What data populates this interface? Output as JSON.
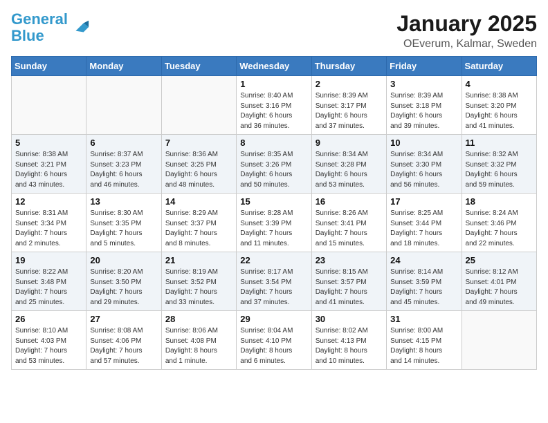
{
  "header": {
    "logo_line1": "General",
    "logo_line2": "Blue",
    "title": "January 2025",
    "subtitle": "OEverum, Kalmar, Sweden"
  },
  "days_of_week": [
    "Sunday",
    "Monday",
    "Tuesday",
    "Wednesday",
    "Thursday",
    "Friday",
    "Saturday"
  ],
  "weeks": [
    [
      {
        "day": "",
        "info": ""
      },
      {
        "day": "",
        "info": ""
      },
      {
        "day": "",
        "info": ""
      },
      {
        "day": "1",
        "info": "Sunrise: 8:40 AM\nSunset: 3:16 PM\nDaylight: 6 hours\nand 36 minutes."
      },
      {
        "day": "2",
        "info": "Sunrise: 8:39 AM\nSunset: 3:17 PM\nDaylight: 6 hours\nand 37 minutes."
      },
      {
        "day": "3",
        "info": "Sunrise: 8:39 AM\nSunset: 3:18 PM\nDaylight: 6 hours\nand 39 minutes."
      },
      {
        "day": "4",
        "info": "Sunrise: 8:38 AM\nSunset: 3:20 PM\nDaylight: 6 hours\nand 41 minutes."
      }
    ],
    [
      {
        "day": "5",
        "info": "Sunrise: 8:38 AM\nSunset: 3:21 PM\nDaylight: 6 hours\nand 43 minutes."
      },
      {
        "day": "6",
        "info": "Sunrise: 8:37 AM\nSunset: 3:23 PM\nDaylight: 6 hours\nand 46 minutes."
      },
      {
        "day": "7",
        "info": "Sunrise: 8:36 AM\nSunset: 3:25 PM\nDaylight: 6 hours\nand 48 minutes."
      },
      {
        "day": "8",
        "info": "Sunrise: 8:35 AM\nSunset: 3:26 PM\nDaylight: 6 hours\nand 50 minutes."
      },
      {
        "day": "9",
        "info": "Sunrise: 8:34 AM\nSunset: 3:28 PM\nDaylight: 6 hours\nand 53 minutes."
      },
      {
        "day": "10",
        "info": "Sunrise: 8:34 AM\nSunset: 3:30 PM\nDaylight: 6 hours\nand 56 minutes."
      },
      {
        "day": "11",
        "info": "Sunrise: 8:32 AM\nSunset: 3:32 PM\nDaylight: 6 hours\nand 59 minutes."
      }
    ],
    [
      {
        "day": "12",
        "info": "Sunrise: 8:31 AM\nSunset: 3:34 PM\nDaylight: 7 hours\nand 2 minutes."
      },
      {
        "day": "13",
        "info": "Sunrise: 8:30 AM\nSunset: 3:35 PM\nDaylight: 7 hours\nand 5 minutes."
      },
      {
        "day": "14",
        "info": "Sunrise: 8:29 AM\nSunset: 3:37 PM\nDaylight: 7 hours\nand 8 minutes."
      },
      {
        "day": "15",
        "info": "Sunrise: 8:28 AM\nSunset: 3:39 PM\nDaylight: 7 hours\nand 11 minutes."
      },
      {
        "day": "16",
        "info": "Sunrise: 8:26 AM\nSunset: 3:41 PM\nDaylight: 7 hours\nand 15 minutes."
      },
      {
        "day": "17",
        "info": "Sunrise: 8:25 AM\nSunset: 3:44 PM\nDaylight: 7 hours\nand 18 minutes."
      },
      {
        "day": "18",
        "info": "Sunrise: 8:24 AM\nSunset: 3:46 PM\nDaylight: 7 hours\nand 22 minutes."
      }
    ],
    [
      {
        "day": "19",
        "info": "Sunrise: 8:22 AM\nSunset: 3:48 PM\nDaylight: 7 hours\nand 25 minutes."
      },
      {
        "day": "20",
        "info": "Sunrise: 8:20 AM\nSunset: 3:50 PM\nDaylight: 7 hours\nand 29 minutes."
      },
      {
        "day": "21",
        "info": "Sunrise: 8:19 AM\nSunset: 3:52 PM\nDaylight: 7 hours\nand 33 minutes."
      },
      {
        "day": "22",
        "info": "Sunrise: 8:17 AM\nSunset: 3:54 PM\nDaylight: 7 hours\nand 37 minutes."
      },
      {
        "day": "23",
        "info": "Sunrise: 8:15 AM\nSunset: 3:57 PM\nDaylight: 7 hours\nand 41 minutes."
      },
      {
        "day": "24",
        "info": "Sunrise: 8:14 AM\nSunset: 3:59 PM\nDaylight: 7 hours\nand 45 minutes."
      },
      {
        "day": "25",
        "info": "Sunrise: 8:12 AM\nSunset: 4:01 PM\nDaylight: 7 hours\nand 49 minutes."
      }
    ],
    [
      {
        "day": "26",
        "info": "Sunrise: 8:10 AM\nSunset: 4:03 PM\nDaylight: 7 hours\nand 53 minutes."
      },
      {
        "day": "27",
        "info": "Sunrise: 8:08 AM\nSunset: 4:06 PM\nDaylight: 7 hours\nand 57 minutes."
      },
      {
        "day": "28",
        "info": "Sunrise: 8:06 AM\nSunset: 4:08 PM\nDaylight: 8 hours\nand 1 minute."
      },
      {
        "day": "29",
        "info": "Sunrise: 8:04 AM\nSunset: 4:10 PM\nDaylight: 8 hours\nand 6 minutes."
      },
      {
        "day": "30",
        "info": "Sunrise: 8:02 AM\nSunset: 4:13 PM\nDaylight: 8 hours\nand 10 minutes."
      },
      {
        "day": "31",
        "info": "Sunrise: 8:00 AM\nSunset: 4:15 PM\nDaylight: 8 hours\nand 14 minutes."
      },
      {
        "day": "",
        "info": ""
      }
    ]
  ]
}
